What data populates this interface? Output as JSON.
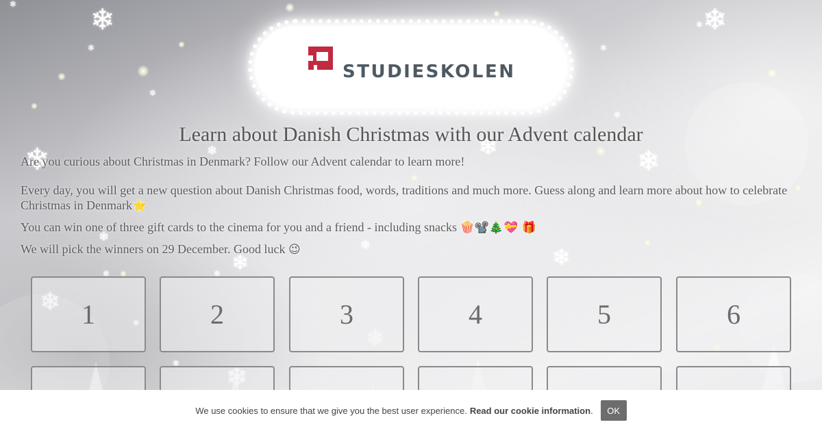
{
  "logo": {
    "text": "STUDIESKOLEN",
    "brand_color": "#c22a3f",
    "text_color": "#4e5a63"
  },
  "title": "Learn about Danish Christmas with our Advent calendar",
  "intro": {
    "p1": "Are you curious about Christmas in Denmark? Follow our Advent calendar to learn more!",
    "p2": "Every day, you will get a new question about Danish Christmas food, words, traditions and much more. Guess along and learn more about how to celebrate Christmas in Denmark",
    "p2_emoji": "⭐",
    "p3": "You can win one of three gift cards to the cinema for you and a friend - including snacks",
    "p3_emoji": "🍿📽️🎄💝 🎁",
    "p4": "We will pick the winners on 29 December. Good luck",
    "p4_emoji": "😉"
  },
  "calendar": {
    "doors": [
      "1",
      "2",
      "3",
      "4",
      "5",
      "6"
    ],
    "next_row_doors": 6
  },
  "cookie": {
    "message": "We use cookies to ensure that we give you the best user experience.",
    "link_label": "Read our cookie information",
    "after_link": ".",
    "ok_label": "OK"
  }
}
